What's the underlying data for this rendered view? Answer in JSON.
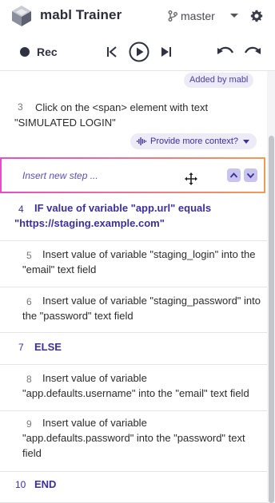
{
  "header": {
    "app_title": "mabl Trainer",
    "branch": "master",
    "icons": [
      "mabl-logo-icon",
      "branch-icon",
      "chevron-down-icon",
      "gear-icon"
    ]
  },
  "toolbar": {
    "rec_label": "Rec",
    "icons": [
      "record-dot-icon",
      "skip-back-icon",
      "play-icon",
      "skip-forward-icon",
      "undo-icon",
      "redo-icon"
    ]
  },
  "badges": {
    "added_by": "Added by mabl",
    "context_button": "Provide more context?"
  },
  "insert": {
    "placeholder": "Insert new step ..."
  },
  "steps": [
    {
      "num": "3",
      "text": "Click on the <span> element with text \"SIMULATED LOGIN\""
    },
    {
      "num": "4",
      "text": "IF value of variable \"app.url\" equals \"https://staging.example.com\""
    },
    {
      "num": "5",
      "text": "Insert value of variable \"staging_login\" into the \"email\" text field"
    },
    {
      "num": "6",
      "text": "Insert value of variable \"staging_password\" into the \"password\" text field"
    },
    {
      "num": "7",
      "text": "ELSE"
    },
    {
      "num": "8",
      "text": "Insert value of variable \"app.defaults.username\" into the \"email\" text field"
    },
    {
      "num": "9",
      "text": "Insert value of variable \"app.defaults.password\" into the \"password\" text field"
    },
    {
      "num": "10",
      "text": "END"
    }
  ],
  "colors": {
    "accent": "#3b2f9c",
    "badge_bg": "#ecebf7",
    "insert_gradient_start": "#e54ec8",
    "insert_gradient_end": "#f39a56"
  }
}
